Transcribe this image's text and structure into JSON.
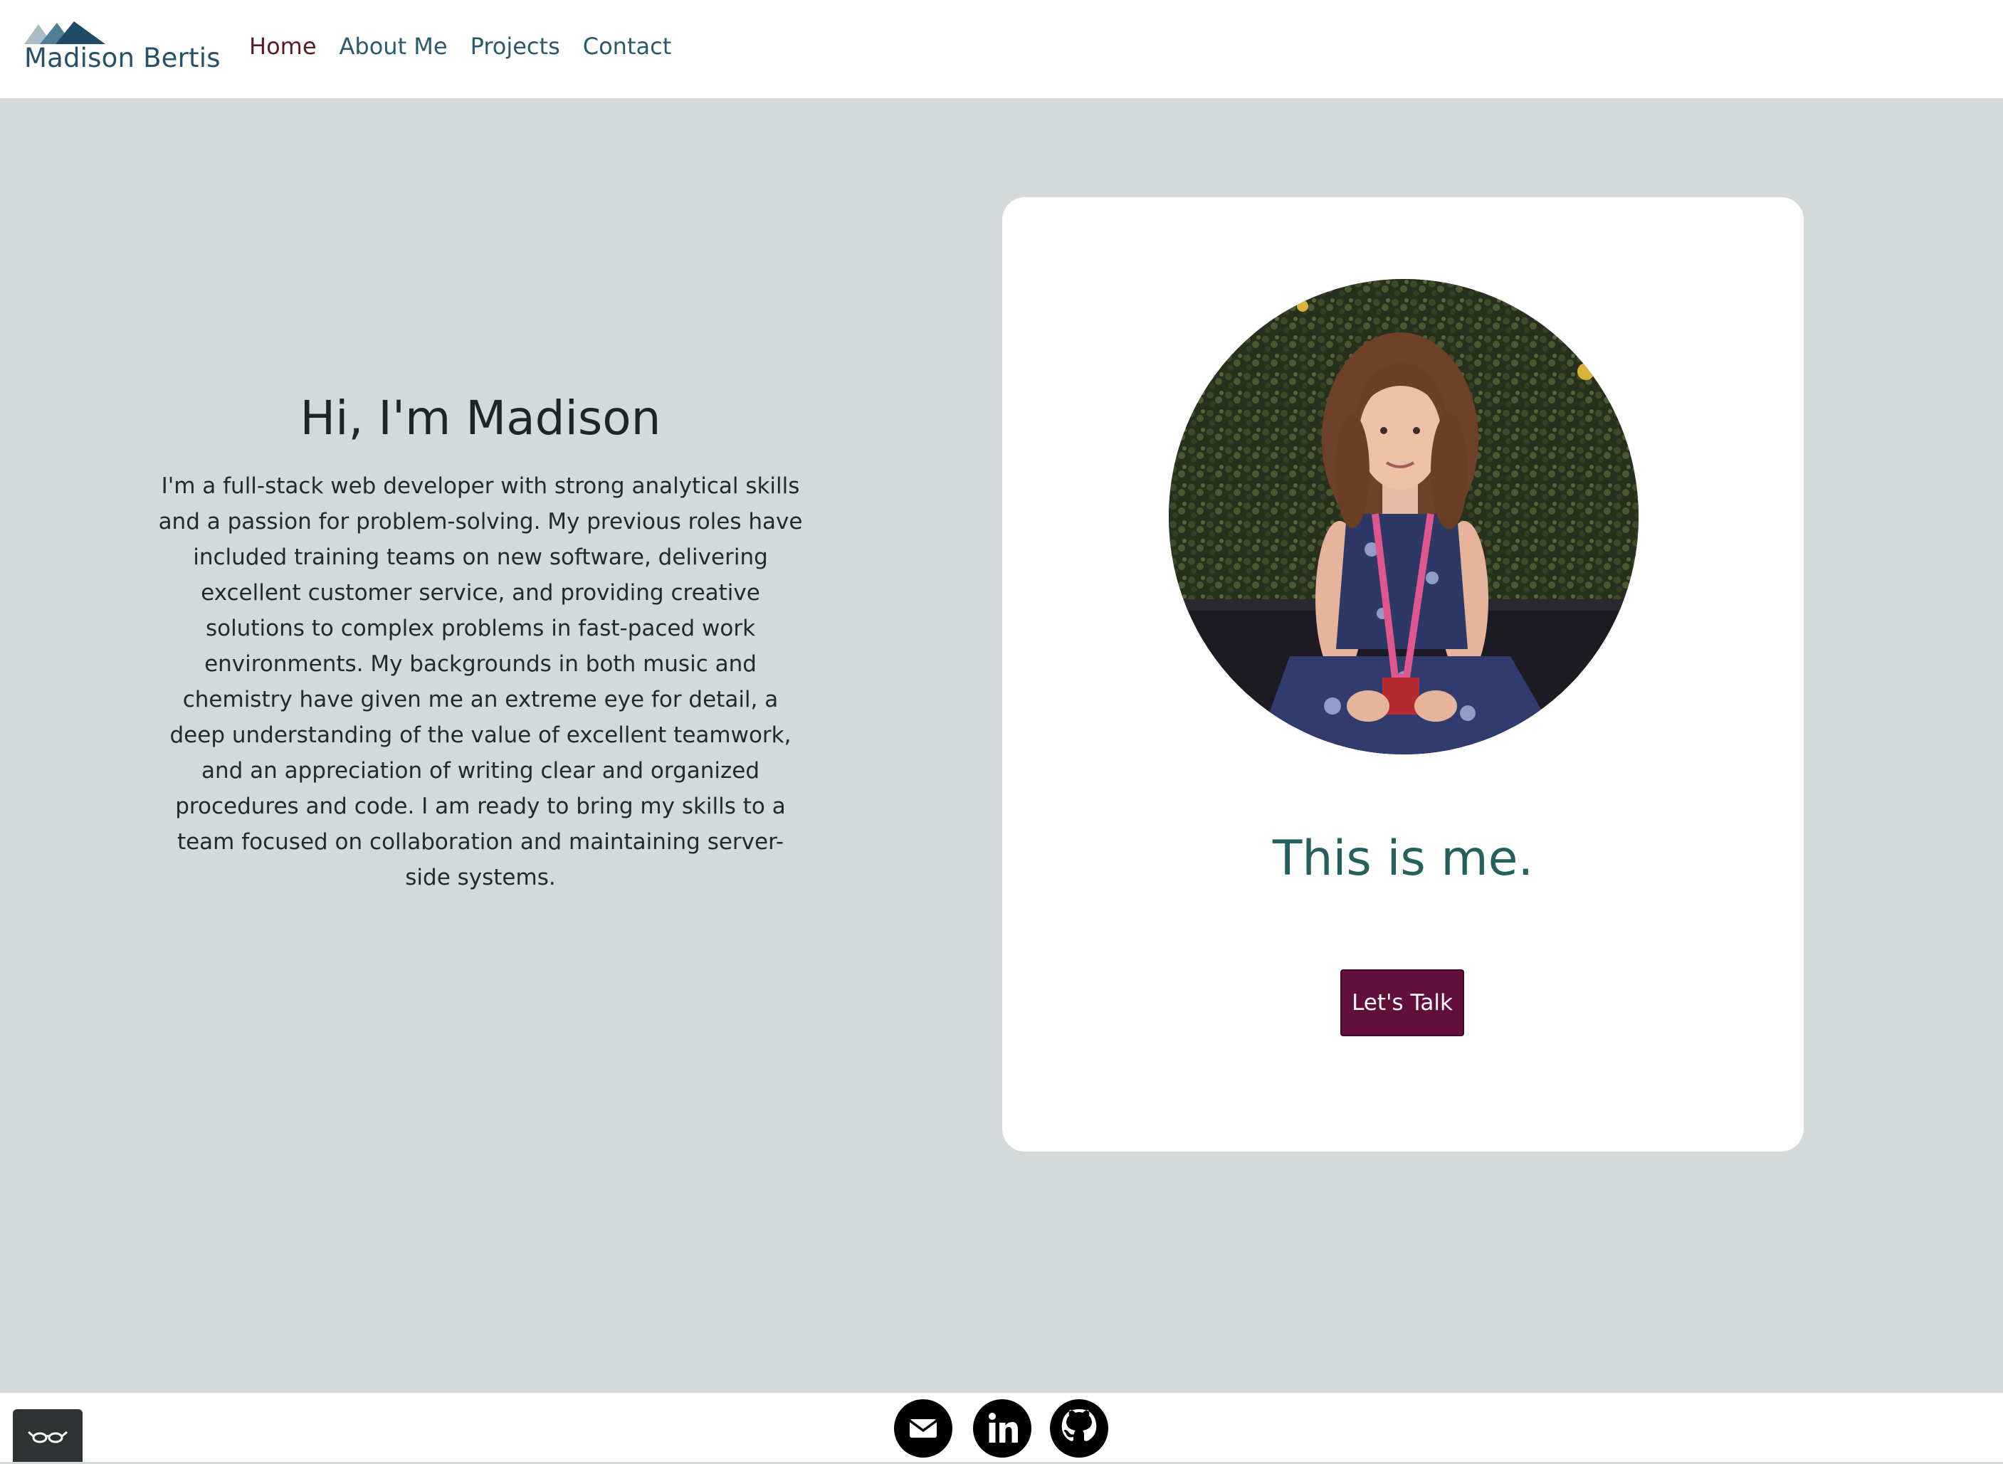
{
  "brand": {
    "name": "Madison Bertis",
    "logo": "mountain-logo"
  },
  "nav": {
    "items": [
      {
        "label": "Home",
        "active": true
      },
      {
        "label": "About Me",
        "active": false
      },
      {
        "label": "Projects",
        "active": false
      },
      {
        "label": "Contact",
        "active": false
      }
    ]
  },
  "intro": {
    "heading": "Hi, I'm Madison",
    "paragraph": "I'm a full-stack web developer with strong analytical skills and a passion for problem-solving. My previous roles have included training teams on new software, delivering excellent customer service, and providing creative solutions to complex problems in fast-paced work environments. My backgrounds in both music and chemistry have given me an extreme eye for detail, a deep understanding of the value of excellent teamwork, and an appreciation of writing clear and organized procedures and code. I am ready to bring my skills to a team focused on collaboration and maintaining server-side systems."
  },
  "card": {
    "photo": "profile-photo",
    "caption": "This is me.",
    "button_label": "Let's Talk"
  },
  "footer": {
    "social": [
      {
        "icon": "email-icon"
      },
      {
        "icon": "linkedin-icon"
      },
      {
        "icon": "github-icon"
      }
    ],
    "accessibility_icon": "glasses-icon"
  },
  "colors": {
    "page_background": "#d4dada",
    "brand": "#24526a",
    "nav_link": "#2a5a6e",
    "nav_active": "#5c1a22",
    "caption": "#23605e",
    "button": "#620f3c"
  }
}
